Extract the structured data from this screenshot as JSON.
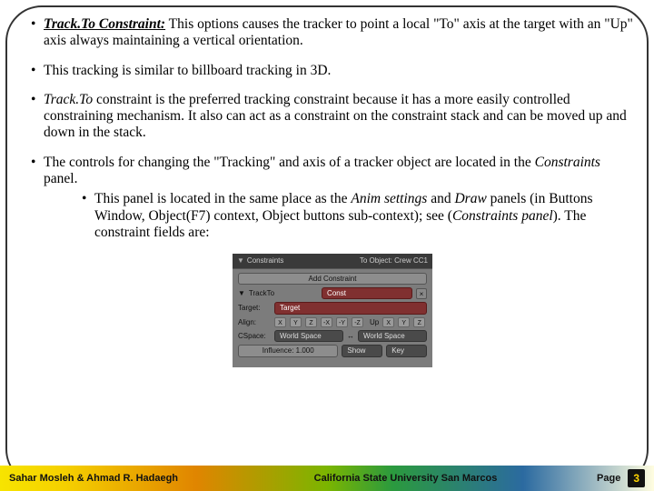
{
  "bullets": {
    "b1_label": "Track.To Constraint:",
    "b1_text": " This options causes the tracker to point a local \"To\" axis at the target with an \"Up\" axis always maintaining a vertical orientation.",
    "b2": "This tracking is similar to billboard tracking in 3D.",
    "b3_pre": "",
    "b3_em": "Track.To",
    "b3_rest": " constraint is the preferred tracking constraint because it has a more easily controlled constraining mechanism. It also can act as a constraint on the constraint stack and can be moved up and down in the stack.",
    "b4_pre": "The controls for changing the \"Tracking\" and axis of a tracker object are located in the ",
    "b4_em": "Constraints",
    "b4_post": " panel.",
    "sub_pre": "This panel is located in the same place as the ",
    "sub_em1": "Anim settings",
    "sub_mid": " and ",
    "sub_em2": "Draw",
    "sub_post1": " panels (in Buttons Window, Object(F7) context, Object buttons sub-context); see (",
    "sub_em3": "Constraints panel",
    "sub_post2": "). The constraint fields are:"
  },
  "panel": {
    "title": "Constraints",
    "header_right": "To Object: Crew CC1",
    "add": "Add Constraint",
    "track": "TrackTo",
    "const_field": "Const",
    "target_lbl": "Target:",
    "target_val": "Target",
    "align_lbl": "Align:",
    "cspace": "CSpace:",
    "space1": "World Space",
    "space2": "World Space",
    "influence_lbl": "Influence: 1.000"
  },
  "footer": {
    "left": "Sahar Mosleh & Ahmad R. Hadaegh",
    "center": "California State University San Marcos",
    "page_label": "Page",
    "page_num": "3"
  }
}
